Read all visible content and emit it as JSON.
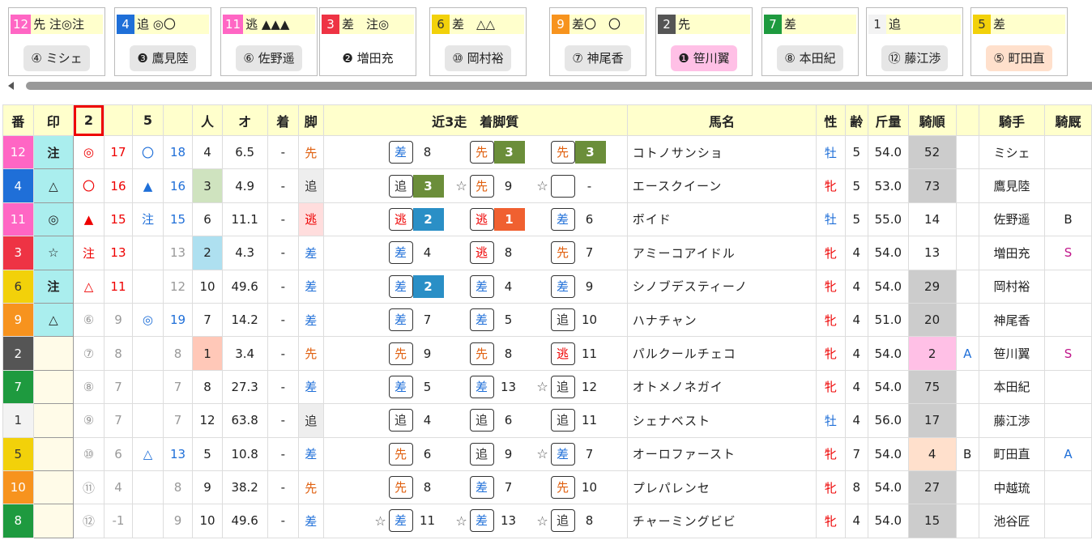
{
  "cards": [
    {
      "num": "12",
      "num_bg": "#ff66c4",
      "num_fg": "#fff",
      "text": "先 注◎注",
      "text_bg": "#ffffcc",
      "jockey": "④ ミシェ",
      "jockey_bg": "#e6e6e6"
    },
    {
      "num": "4",
      "num_bg": "#1f6fd8",
      "num_fg": "#fff",
      "text": "追 ◎〇",
      "text_bg": "#ffffcc",
      "jockey": "❸ 鷹見陸",
      "jockey_bg": "#e6e6e6"
    },
    {
      "num": "11",
      "num_bg": "#ff66c4",
      "num_fg": "#fff",
      "text": "逃 ▲▲▲",
      "text_bg": "#ffffcc",
      "jockey": "⑥ 佐野遥",
      "jockey_bg": "#e6e6e6"
    },
    {
      "num": "3",
      "num_bg": "#ee3344",
      "num_fg": "#fff",
      "text": "差　注◎",
      "text_bg": "#ffffcc",
      "jockey": "❷ 増田充",
      "jockey_bg": "#ffffff"
    },
    {
      "num": "6",
      "num_bg": "#f2d10a",
      "num_fg": "#333",
      "text": "差　△△",
      "text_bg": "#ffffcc",
      "jockey": "⑩ 岡村裕",
      "jockey_bg": "#e6e6e6"
    },
    {
      "num": "9",
      "num_bg": "#f7931e",
      "num_fg": "#fff",
      "text": "差〇　〇",
      "text_bg": "#ffffcc",
      "jockey": "⑦ 神尾香",
      "jockey_bg": "#e6e6e6"
    },
    {
      "num": "2",
      "num_bg": "#555555",
      "num_fg": "#fff",
      "text": "先",
      "text_bg": "#ffffcc",
      "jockey": "❶ 笹川翼",
      "jockey_bg": "#ffc0e6"
    },
    {
      "num": "7",
      "num_bg": "#1e9a3f",
      "num_fg": "#fff",
      "text": "差",
      "text_bg": "#ffffcc",
      "jockey": "⑧ 本田紀",
      "jockey_bg": "#e6e6e6"
    },
    {
      "num": "1",
      "num_bg": "#f3f3f3",
      "num_fg": "#333",
      "text": "追",
      "text_bg": "#ffffcc",
      "jockey": "⑫ 藤江渉",
      "jockey_bg": "#e6e6e6"
    },
    {
      "num": "5",
      "num_bg": "#f2d10a",
      "num_fg": "#333",
      "text": "差",
      "text_bg": "#ffffcc",
      "jockey": "⑤ 町田直",
      "jockey_bg": "#ffe0cc"
    }
  ],
  "headers": {
    "ban": "番",
    "shirushi": "印",
    "c2": "2",
    "c5": "5",
    "nin": "人",
    "odds": "オ",
    "chaku": "着",
    "kyaku": "脚",
    "recent": "近3走　着脚質",
    "name": "馬名",
    "sex": "性",
    "age": "齢",
    "kin": "斤量",
    "kijun": "騎順",
    "kishu": "騎手",
    "kiu": "騎厩"
  },
  "rows": [
    {
      "ban": "12",
      "ban_bg": "#ff66c4",
      "ban_fg": "#fff",
      "mark": "注",
      "mark_bg": "#aaeeee",
      "m1": "◎",
      "m1c": "#e00",
      "v1": "17",
      "v1c": "#e00",
      "m2": "〇",
      "m2c": "#1f6fd8",
      "v2": "18",
      "v2c": "#1f6fd8",
      "nin": "4",
      "nin_bg": "",
      "odds": "6.5",
      "chaku": "-",
      "kyaku": "先",
      "kyaku_c": "#e06010",
      "kyaku_bg": "",
      "r": [
        {
          "s": "",
          "b": "差",
          "bc": "#1f6fd8",
          "n": "8",
          "nbg": "",
          "nc": "#222"
        },
        {
          "s": "",
          "b": "先",
          "bc": "#e06010",
          "n": "3",
          "nbg": "#6b8e3a",
          "nc": "#fff"
        },
        {
          "s": "",
          "b": "先",
          "bc": "#e06010",
          "n": "3",
          "nbg": "#6b8e3a",
          "nc": "#fff"
        }
      ],
      "name": "コトノサンショ",
      "sex": "牡",
      "sexc": "#1f6fd8",
      "age": "5",
      "kin": "54.0",
      "kijun": "52",
      "kijun_bg": "#cccccc",
      "kA": "",
      "kishu": "ミシェ",
      "kiu": "",
      "kiuc": "#222"
    },
    {
      "ban": "4",
      "ban_bg": "#1f6fd8",
      "ban_fg": "#fff",
      "mark": "△",
      "mark_bg": "#aaeeee",
      "m1": "〇",
      "m1c": "#e00",
      "v1": "16",
      "v1c": "#e00",
      "m2": "▲",
      "m2c": "#1f6fd8",
      "v2": "16",
      "v2c": "#1f6fd8",
      "nin": "3",
      "nin_bg": "#cfe3bf",
      "odds": "4.9",
      "chaku": "-",
      "kyaku": "追",
      "kyaku_c": "#333",
      "kyaku_bg": "#eeeeee",
      "r": [
        {
          "s": "",
          "b": "追",
          "bc": "#333",
          "n": "3",
          "nbg": "#6b8e3a",
          "nc": "#fff"
        },
        {
          "s": "☆",
          "b": "先",
          "bc": "#e06010",
          "n": "9",
          "nbg": "",
          "nc": "#222"
        },
        {
          "s": "☆",
          "b": "",
          "bc": "#333",
          "n": "-",
          "nbg": "",
          "nc": "#222"
        }
      ],
      "name": "エースクイーン",
      "sex": "牝",
      "sexc": "#e00",
      "age": "5",
      "kin": "53.0",
      "kijun": "73",
      "kijun_bg": "#cccccc",
      "kA": "",
      "kishu": "鷹見陸",
      "kiu": "",
      "kiuc": "#222"
    },
    {
      "ban": "11",
      "ban_bg": "#ff66c4",
      "ban_fg": "#fff",
      "mark": "◎",
      "mark_bg": "#aaeeee",
      "m1": "▲",
      "m1c": "#e00",
      "v1": "15",
      "v1c": "#e00",
      "m2": "注",
      "m2c": "#1f6fd8",
      "v2": "15",
      "v2c": "#1f6fd8",
      "nin": "6",
      "nin_bg": "",
      "odds": "11.1",
      "chaku": "-",
      "kyaku": "逃",
      "kyaku_c": "#e00",
      "kyaku_bg": "#ffdddd",
      "r": [
        {
          "s": "",
          "b": "逃",
          "bc": "#e00",
          "n": "2",
          "nbg": "#2a8fc6",
          "nc": "#fff"
        },
        {
          "s": "",
          "b": "逃",
          "bc": "#e00",
          "n": "1",
          "nbg": "#f06030",
          "nc": "#fff"
        },
        {
          "s": "",
          "b": "差",
          "bc": "#1f6fd8",
          "n": "6",
          "nbg": "",
          "nc": "#222"
        }
      ],
      "name": "ボイド",
      "sex": "牡",
      "sexc": "#1f6fd8",
      "age": "5",
      "kin": "55.0",
      "kijun": "14",
      "kijun_bg": "",
      "kA": "",
      "kishu": "佐野遥",
      "kiu": "B",
      "kiuc": "#222"
    },
    {
      "ban": "3",
      "ban_bg": "#ee3344",
      "ban_fg": "#fff",
      "mark": "☆",
      "mark_bg": "#aaeeee",
      "m1": "注",
      "m1c": "#e00",
      "v1": "13",
      "v1c": "#e00",
      "m2": "",
      "m2c": "#1f6fd8",
      "v2": "13",
      "v2c": "#999",
      "nin": "2",
      "nin_bg": "#aee0f0",
      "odds": "4.3",
      "chaku": "-",
      "kyaku": "差",
      "kyaku_c": "#1f6fd8",
      "kyaku_bg": "",
      "r": [
        {
          "s": "",
          "b": "差",
          "bc": "#1f6fd8",
          "n": "4",
          "nbg": "",
          "nc": "#222"
        },
        {
          "s": "",
          "b": "逃",
          "bc": "#e00",
          "n": "8",
          "nbg": "",
          "nc": "#222"
        },
        {
          "s": "",
          "b": "先",
          "bc": "#e06010",
          "n": "7",
          "nbg": "",
          "nc": "#222"
        }
      ],
      "name": "アミーコアイドル",
      "sex": "牝",
      "sexc": "#e00",
      "age": "4",
      "kin": "54.0",
      "kijun": "13",
      "kijun_bg": "",
      "kA": "",
      "kishu": "増田充",
      "kiu": "S",
      "kiuc": "#c0168a"
    },
    {
      "ban": "6",
      "ban_bg": "#f2d10a",
      "ban_fg": "#333",
      "mark": "注",
      "mark_bg": "#aaeeee",
      "m1": "△",
      "m1c": "#e00",
      "v1": "11",
      "v1c": "#e00",
      "m2": "",
      "m2c": "#1f6fd8",
      "v2": "12",
      "v2c": "#999",
      "nin": "10",
      "nin_bg": "",
      "odds": "49.6",
      "chaku": "-",
      "kyaku": "差",
      "kyaku_c": "#1f6fd8",
      "kyaku_bg": "",
      "r": [
        {
          "s": "",
          "b": "差",
          "bc": "#1f6fd8",
          "n": "2",
          "nbg": "#2a8fc6",
          "nc": "#fff"
        },
        {
          "s": "",
          "b": "差",
          "bc": "#1f6fd8",
          "n": "4",
          "nbg": "",
          "nc": "#222"
        },
        {
          "s": "",
          "b": "差",
          "bc": "#1f6fd8",
          "n": "9",
          "nbg": "",
          "nc": "#222"
        }
      ],
      "name": "シノブデスティーノ",
      "sex": "牝",
      "sexc": "#e00",
      "age": "4",
      "kin": "54.0",
      "kijun": "29",
      "kijun_bg": "#cccccc",
      "kA": "",
      "kishu": "岡村裕",
      "kiu": "",
      "kiuc": "#222"
    },
    {
      "ban": "9",
      "ban_bg": "#f7931e",
      "ban_fg": "#fff",
      "mark": "△",
      "mark_bg": "#aaeeee",
      "m1": "⑥",
      "m1c": "#999",
      "v1": "9",
      "v1c": "#999",
      "m2": "◎",
      "m2c": "#1f6fd8",
      "v2": "19",
      "v2c": "#1f6fd8",
      "nin": "7",
      "nin_bg": "",
      "odds": "14.2",
      "chaku": "-",
      "kyaku": "差",
      "kyaku_c": "#1f6fd8",
      "kyaku_bg": "",
      "r": [
        {
          "s": "",
          "b": "差",
          "bc": "#1f6fd8",
          "n": "7",
          "nbg": "",
          "nc": "#222"
        },
        {
          "s": "",
          "b": "差",
          "bc": "#1f6fd8",
          "n": "5",
          "nbg": "",
          "nc": "#222"
        },
        {
          "s": "",
          "b": "追",
          "bc": "#333",
          "n": "10",
          "nbg": "",
          "nc": "#222"
        }
      ],
      "name": "ハナチャン",
      "sex": "牝",
      "sexc": "#e00",
      "age": "4",
      "kin": "51.0",
      "kijun": "20",
      "kijun_bg": "#cccccc",
      "kA": "",
      "kishu": "神尾香",
      "kiu": "",
      "kiuc": "#222"
    },
    {
      "ban": "2",
      "ban_bg": "#555555",
      "ban_fg": "#fff",
      "mark": "",
      "mark_bg": "#fffbe8",
      "m1": "⑦",
      "m1c": "#999",
      "v1": "8",
      "v1c": "#999",
      "m2": "",
      "m2c": "#1f6fd8",
      "v2": "8",
      "v2c": "#999",
      "nin": "1",
      "nin_bg": "#ffc8b8",
      "odds": "3.4",
      "chaku": "-",
      "kyaku": "先",
      "kyaku_c": "#e06010",
      "kyaku_bg": "",
      "r": [
        {
          "s": "",
          "b": "先",
          "bc": "#e06010",
          "n": "9",
          "nbg": "",
          "nc": "#222"
        },
        {
          "s": "",
          "b": "先",
          "bc": "#e06010",
          "n": "8",
          "nbg": "",
          "nc": "#222"
        },
        {
          "s": "",
          "b": "逃",
          "bc": "#e00",
          "n": "11",
          "nbg": "",
          "nc": "#222"
        }
      ],
      "name": "パルクールチェコ",
      "sex": "牝",
      "sexc": "#e00",
      "age": "4",
      "kin": "54.0",
      "kijun": "2",
      "kijun_bg": "#ffc0e6",
      "kA": "A",
      "kishu": "笹川翼",
      "kiu": "S",
      "kiuc": "#c0168a"
    },
    {
      "ban": "7",
      "ban_bg": "#1e9a3f",
      "ban_fg": "#fff",
      "mark": "",
      "mark_bg": "#fffbe8",
      "m1": "⑧",
      "m1c": "#999",
      "v1": "7",
      "v1c": "#999",
      "m2": "",
      "m2c": "#1f6fd8",
      "v2": "7",
      "v2c": "#999",
      "nin": "8",
      "nin_bg": "",
      "odds": "27.3",
      "chaku": "-",
      "kyaku": "差",
      "kyaku_c": "#1f6fd8",
      "kyaku_bg": "",
      "r": [
        {
          "s": "",
          "b": "差",
          "bc": "#1f6fd8",
          "n": "5",
          "nbg": "",
          "nc": "#222"
        },
        {
          "s": "",
          "b": "差",
          "bc": "#1f6fd8",
          "n": "13",
          "nbg": "",
          "nc": "#222"
        },
        {
          "s": "☆",
          "b": "追",
          "bc": "#333",
          "n": "12",
          "nbg": "",
          "nc": "#222"
        }
      ],
      "name": "オトメノネガイ",
      "sex": "牝",
      "sexc": "#e00",
      "age": "4",
      "kin": "54.0",
      "kijun": "75",
      "kijun_bg": "#cccccc",
      "kA": "",
      "kishu": "本田紀",
      "kiu": "",
      "kiuc": "#222"
    },
    {
      "ban": "1",
      "ban_bg": "#f3f3f3",
      "ban_fg": "#333",
      "mark": "",
      "mark_bg": "#fffbe8",
      "m1": "⑨",
      "m1c": "#999",
      "v1": "7",
      "v1c": "#999",
      "m2": "",
      "m2c": "#1f6fd8",
      "v2": "7",
      "v2c": "#999",
      "nin": "12",
      "nin_bg": "",
      "odds": "63.8",
      "chaku": "-",
      "kyaku": "追",
      "kyaku_c": "#333",
      "kyaku_bg": "#eeeeee",
      "r": [
        {
          "s": "",
          "b": "追",
          "bc": "#333",
          "n": "4",
          "nbg": "",
          "nc": "#222"
        },
        {
          "s": "",
          "b": "追",
          "bc": "#333",
          "n": "6",
          "nbg": "",
          "nc": "#222"
        },
        {
          "s": "",
          "b": "追",
          "bc": "#333",
          "n": "11",
          "nbg": "",
          "nc": "#222"
        }
      ],
      "name": "シェナベスト",
      "sex": "牡",
      "sexc": "#1f6fd8",
      "age": "4",
      "kin": "56.0",
      "kijun": "17",
      "kijun_bg": "#cccccc",
      "kA": "",
      "kishu": "藤江渉",
      "kiu": "",
      "kiuc": "#222"
    },
    {
      "ban": "5",
      "ban_bg": "#f2d10a",
      "ban_fg": "#333",
      "mark": "",
      "mark_bg": "#fffbe8",
      "m1": "⑩",
      "m1c": "#999",
      "v1": "6",
      "v1c": "#999",
      "m2": "△",
      "m2c": "#1f6fd8",
      "v2": "13",
      "v2c": "#1f6fd8",
      "nin": "5",
      "nin_bg": "",
      "odds": "10.8",
      "chaku": "-",
      "kyaku": "差",
      "kyaku_c": "#1f6fd8",
      "kyaku_bg": "",
      "r": [
        {
          "s": "",
          "b": "先",
          "bc": "#e06010",
          "n": "6",
          "nbg": "",
          "nc": "#222"
        },
        {
          "s": "",
          "b": "追",
          "bc": "#333",
          "n": "9",
          "nbg": "",
          "nc": "#222"
        },
        {
          "s": "☆",
          "b": "差",
          "bc": "#1f6fd8",
          "n": "7",
          "nbg": "",
          "nc": "#222"
        }
      ],
      "name": "オーロファースト",
      "sex": "牝",
      "sexc": "#e00",
      "age": "7",
      "kin": "54.0",
      "kijun": "4",
      "kijun_bg": "#ffe0cc",
      "kA": "B",
      "kishu": "町田直",
      "kiu": "A",
      "kiuc": "#1f6fd8"
    },
    {
      "ban": "10",
      "ban_bg": "#f7931e",
      "ban_fg": "#fff",
      "mark": "",
      "mark_bg": "#fffbe8",
      "m1": "⑪",
      "m1c": "#999",
      "v1": "4",
      "v1c": "#999",
      "m2": "",
      "m2c": "#1f6fd8",
      "v2": "8",
      "v2c": "#999",
      "nin": "9",
      "nin_bg": "",
      "odds": "38.2",
      "chaku": "-",
      "kyaku": "先",
      "kyaku_c": "#e06010",
      "kyaku_bg": "",
      "r": [
        {
          "s": "",
          "b": "先",
          "bc": "#e06010",
          "n": "8",
          "nbg": "",
          "nc": "#222"
        },
        {
          "s": "",
          "b": "差",
          "bc": "#1f6fd8",
          "n": "7",
          "nbg": "",
          "nc": "#222"
        },
        {
          "s": "",
          "b": "先",
          "bc": "#e06010",
          "n": "10",
          "nbg": "",
          "nc": "#222"
        }
      ],
      "name": "プレパレンセ",
      "sex": "牝",
      "sexc": "#e00",
      "age": "8",
      "kin": "54.0",
      "kijun": "27",
      "kijun_bg": "#cccccc",
      "kA": "",
      "kishu": "中越琉",
      "kiu": "",
      "kiuc": "#222"
    },
    {
      "ban": "8",
      "ban_bg": "#1e9a3f",
      "ban_fg": "#fff",
      "mark": "",
      "mark_bg": "#fffbe8",
      "m1": "⑫",
      "m1c": "#999",
      "v1": "-1",
      "v1c": "#999",
      "m2": "",
      "m2c": "#1f6fd8",
      "v2": "9",
      "v2c": "#999",
      "nin": "10",
      "nin_bg": "",
      "odds": "49.6",
      "chaku": "-",
      "kyaku": "差",
      "kyaku_c": "#1f6fd8",
      "kyaku_bg": "",
      "r": [
        {
          "s": "☆",
          "b": "差",
          "bc": "#1f6fd8",
          "n": "11",
          "nbg": "",
          "nc": "#222"
        },
        {
          "s": "☆",
          "b": "差",
          "bc": "#1f6fd8",
          "n": "13",
          "nbg": "",
          "nc": "#222"
        },
        {
          "s": "☆",
          "b": "追",
          "bc": "#333",
          "n": "8",
          "nbg": "",
          "nc": "#222"
        }
      ],
      "name": "チャーミングビビ",
      "sex": "牝",
      "sexc": "#e00",
      "age": "4",
      "kin": "54.0",
      "kijun": "15",
      "kijun_bg": "#cccccc",
      "kA": "",
      "kishu": "池谷匠",
      "kiu": "",
      "kiuc": "#222"
    }
  ]
}
